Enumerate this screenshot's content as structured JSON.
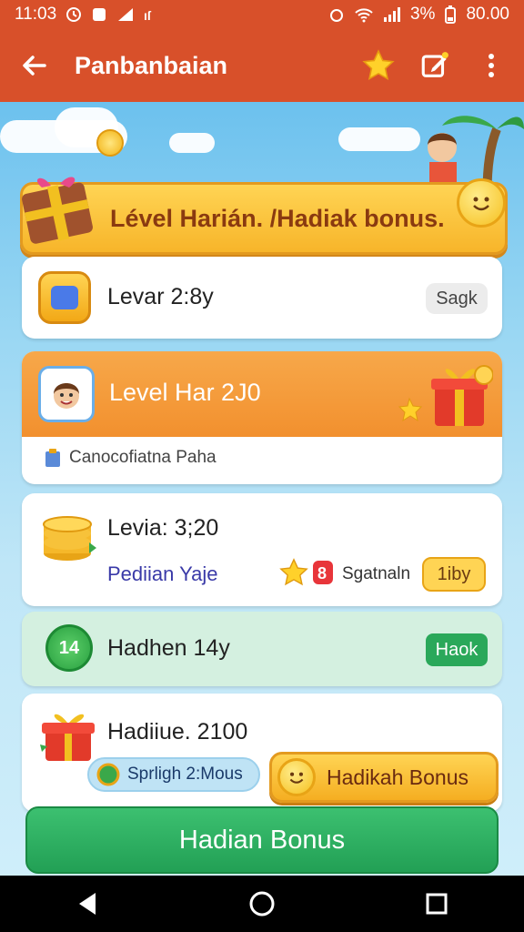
{
  "status_bar": {
    "time": "11:03",
    "battery": "3%",
    "clock_right": "80.00"
  },
  "app_bar": {
    "title": "Panbanbaian"
  },
  "banner": {
    "text": "Lével Harián. /Hadiak bonus."
  },
  "card_level_day": {
    "title": "Levar 2:8y",
    "pill": "Sagk"
  },
  "card_level_header": {
    "title": "Level Har 2J0",
    "subtitle": "Canocofiatna Paha"
  },
  "card_coins": {
    "title": "Levia: 3;20",
    "link": "Pediian Yaje",
    "status": "Sgatnaln",
    "pill": "1iby"
  },
  "card_green": {
    "badge": "14",
    "title": "Hadhen 14y",
    "button": "Haok"
  },
  "card_gift": {
    "title": "Hadiiue. 2100",
    "chip": "Sprligh 2:Mous",
    "bonus_button": "Hadikah Bonus"
  },
  "main_button": {
    "label": "Hadian Bonus"
  },
  "colors": {
    "app_bar": "#d8502a",
    "banner": "#f7b52a",
    "orange_header": "#f49a3c",
    "green": "#2aa85a",
    "mint": "#d4f0e0"
  }
}
